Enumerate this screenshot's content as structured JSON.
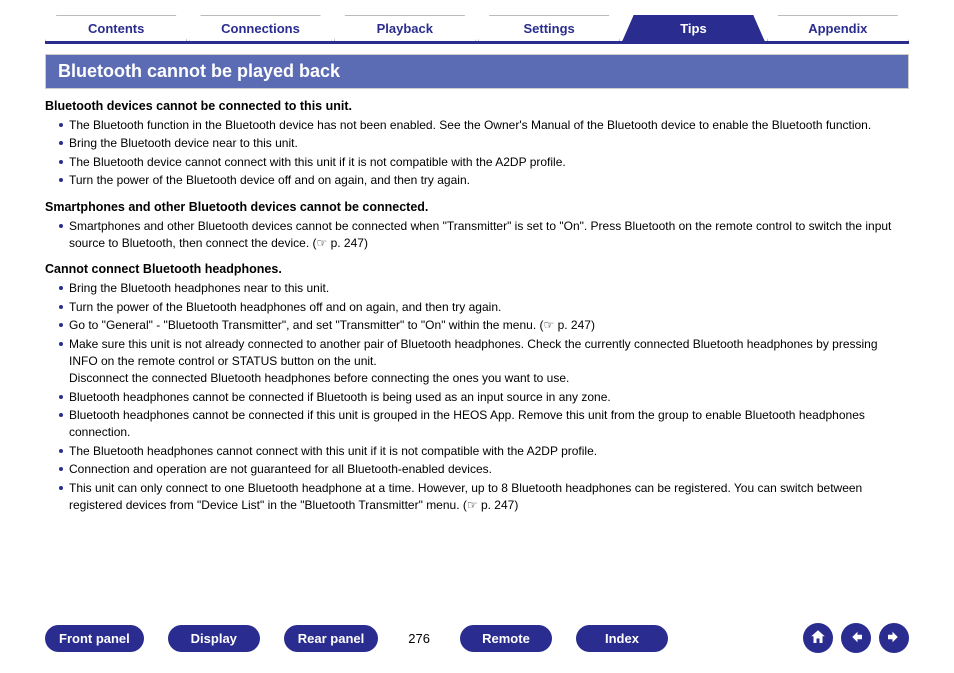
{
  "tabs": [
    {
      "label": "Contents",
      "active": false
    },
    {
      "label": "Connections",
      "active": false
    },
    {
      "label": "Playback",
      "active": false
    },
    {
      "label": "Settings",
      "active": false
    },
    {
      "label": "Tips",
      "active": true
    },
    {
      "label": "Appendix",
      "active": false
    }
  ],
  "title": "Bluetooth cannot be played back",
  "sections": [
    {
      "heading": "Bluetooth devices cannot be connected to this unit.",
      "items": [
        "The Bluetooth function in the Bluetooth device has not been enabled. See the Owner's Manual of the Bluetooth device to enable the Bluetooth function.",
        "Bring the Bluetooth device near to this unit.",
        "The Bluetooth device cannot connect with this unit if it is not compatible with the A2DP profile.",
        "Turn the power of the Bluetooth device off and on again, and then try again."
      ]
    },
    {
      "heading": "Smartphones and other Bluetooth devices cannot be connected.",
      "items": [
        "Smartphones and other Bluetooth devices cannot be connected when \"Transmitter\" is set to \"On\". Press Bluetooth on the remote control to switch the input source to Bluetooth, then connect the device.  (☞ p. 247)"
      ]
    },
    {
      "heading": "Cannot connect Bluetooth headphones.",
      "items": [
        "Bring the Bluetooth headphones near to this unit.",
        "Turn the power of the Bluetooth headphones off and on again, and then try again.",
        "Go to \"General\" - \"Bluetooth Transmitter\", and set \"Transmitter\" to \"On\" within the menu.  (☞ p. 247)",
        "Make sure this unit is not already connected to another pair of Bluetooth headphones. Check the currently connected Bluetooth headphones by pressing INFO on the remote control or STATUS button on the unit.\nDisconnect the connected Bluetooth headphones before connecting the ones you want to use.",
        "Bluetooth headphones cannot be connected if Bluetooth is being used as an input source in any zone.",
        "Bluetooth headphones cannot be connected if this unit is grouped in the HEOS App. Remove this unit from the group to enable Bluetooth headphones connection.",
        "The Bluetooth headphones cannot connect with this unit if it is not compatible with the A2DP profile.",
        "Connection and operation are not guaranteed for all Bluetooth-enabled devices.",
        "This unit can only connect to one Bluetooth headphone at a time. However, up to 8 Bluetooth headphones can be registered. You can switch between registered devices from \"Device List\" in the \"Bluetooth Transmitter\" menu.  (☞ p. 247)"
      ]
    }
  ],
  "bottom": {
    "buttons": [
      "Front panel",
      "Display",
      "Rear panel"
    ],
    "page": "276",
    "buttons2": [
      "Remote",
      "Index"
    ]
  }
}
